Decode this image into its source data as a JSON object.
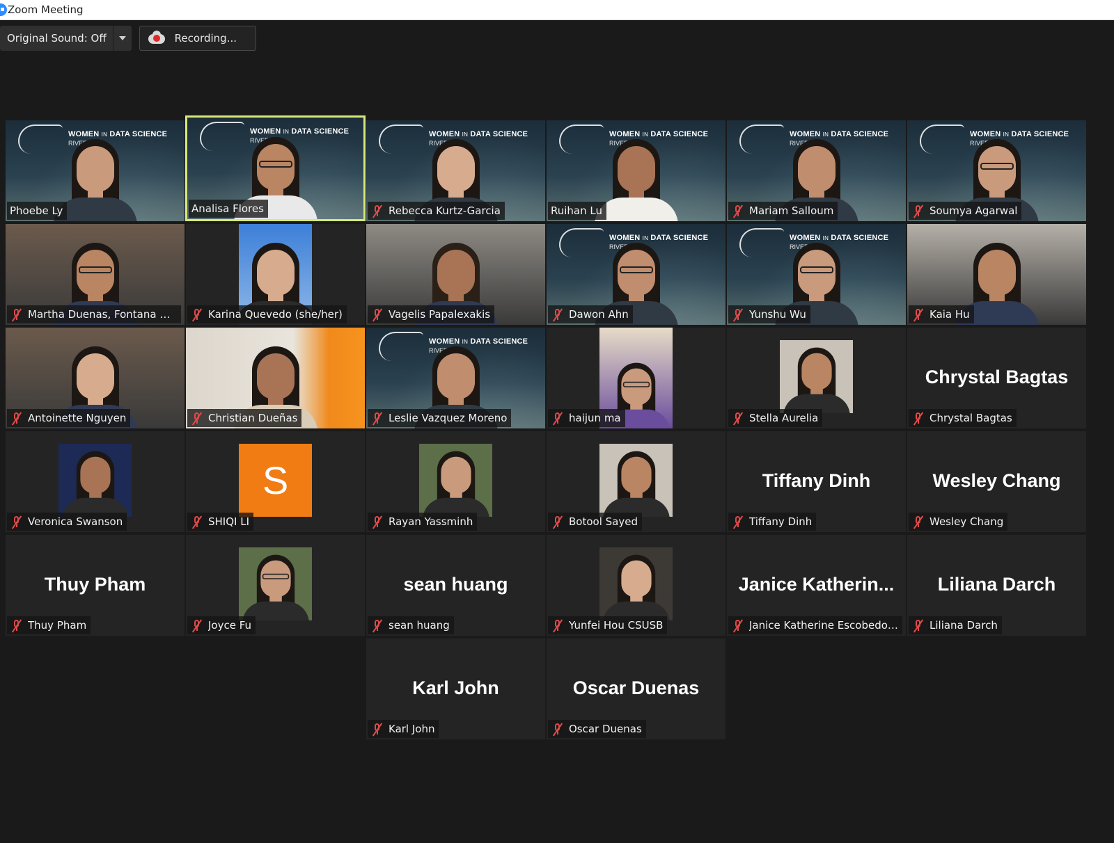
{
  "window": {
    "title": "Zoom Meeting"
  },
  "toolbar": {
    "original_sound_label": "Original Sound: Off",
    "recording_label": "Recording..."
  },
  "branding": {
    "line1_a": "WOMEN",
    "line1_in": "IN",
    "line1_b": "DATA SCIENCE",
    "line2": "RIVERSIDE"
  },
  "participants": [
    {
      "name": "Phoebe Ly",
      "muted": false,
      "video": "wids"
    },
    {
      "name": "Analisa Flores",
      "muted": false,
      "video": "wids",
      "active_speaker": true
    },
    {
      "name": "Rebecca Kurtz-Garcia",
      "muted": true,
      "video": "wids"
    },
    {
      "name": "Ruihan Lu",
      "muted": false,
      "video": "wids"
    },
    {
      "name": "Mariam Salloum",
      "muted": true,
      "video": "wids"
    },
    {
      "name": "Soumya Agarwal",
      "muted": true,
      "video": "wids"
    },
    {
      "name": "Martha Duenas, Fontana USD",
      "muted": true,
      "video": "camera"
    },
    {
      "name": "Karina Quevedo (she/her)",
      "muted": true,
      "video": "camera"
    },
    {
      "name": "Vagelis Papalexakis",
      "muted": true,
      "video": "camera"
    },
    {
      "name": "Dawon Ahn",
      "muted": true,
      "video": "wids"
    },
    {
      "name": "Yunshu Wu",
      "muted": true,
      "video": "wids"
    },
    {
      "name": "Kaia Hu",
      "muted": true,
      "video": "camera"
    },
    {
      "name": "Antoinette Nguyen",
      "muted": true,
      "video": "camera"
    },
    {
      "name": "Christian Dueñas",
      "muted": true,
      "video": "camera"
    },
    {
      "name": "Leslie Vazquez Moreno",
      "muted": true,
      "video": "wids"
    },
    {
      "name": "haijun ma",
      "muted": true,
      "video": "photo"
    },
    {
      "name": "Stella Aurelia",
      "muted": true,
      "video": "photo"
    },
    {
      "name": "Chrystal Bagtas",
      "muted": true,
      "video": "off",
      "big_name": "Chrystal Bagtas"
    },
    {
      "name": "Veronica Swanson",
      "muted": true,
      "video": "photo"
    },
    {
      "name": "SHIQI LI",
      "muted": true,
      "video": "avatar",
      "avatar_letter": "S"
    },
    {
      "name": "Rayan Yassminh",
      "muted": true,
      "video": "photo"
    },
    {
      "name": "Botool Sayed",
      "muted": true,
      "video": "photo"
    },
    {
      "name": "Tiffany Dinh",
      "muted": true,
      "video": "off",
      "big_name": "Tiffany Dinh"
    },
    {
      "name": "Wesley Chang",
      "muted": true,
      "video": "off",
      "big_name": "Wesley Chang"
    },
    {
      "name": "Thuy Pham",
      "muted": true,
      "video": "off",
      "big_name": "Thuy Pham"
    },
    {
      "name": "Joyce Fu",
      "muted": true,
      "video": "photo"
    },
    {
      "name": "sean huang",
      "muted": true,
      "video": "off",
      "big_name": "sean huang"
    },
    {
      "name": "Yunfei Hou CSUSB",
      "muted": true,
      "video": "photo"
    },
    {
      "name": "Janice Katherine Escobedo V...",
      "muted": true,
      "video": "off",
      "big_name": "Janice  Katherin..."
    },
    {
      "name": "Liliana Darch",
      "muted": true,
      "video": "off",
      "big_name": "Liliana Darch"
    },
    {
      "name": "Karl John",
      "muted": true,
      "video": "off",
      "big_name": "Karl John"
    },
    {
      "name": "Oscar Duenas",
      "muted": true,
      "video": "off",
      "big_name": "Oscar Duenas"
    }
  ],
  "icons": {
    "muted": "mic-muted-icon",
    "recording": "cloud-record-icon",
    "dropdown": "chevron-down-icon"
  }
}
